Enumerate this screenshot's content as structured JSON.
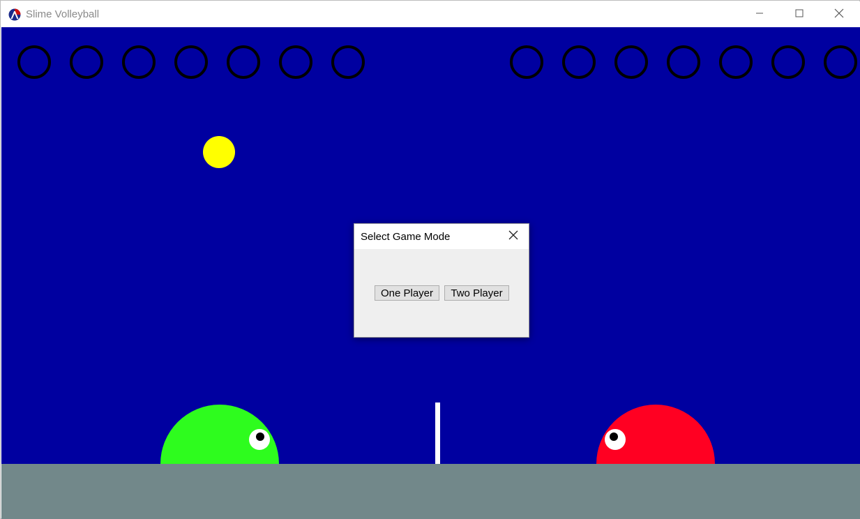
{
  "window": {
    "title": "Slime Volleyball",
    "controls": [
      "minimize-icon",
      "maximize-icon",
      "close-icon"
    ]
  },
  "game": {
    "background_color": "#0000a0",
    "ground_color": "#72888a",
    "net_color": "#ffffff",
    "ball_color": "#ffff00",
    "left_player": {
      "color": "#2efc1e",
      "points_remaining": 7
    },
    "right_player": {
      "color": "#ff0022",
      "points_remaining": 7
    }
  },
  "dialog": {
    "title": "Select Game Mode",
    "close_icon": "close-icon",
    "one_player_label": "One Player",
    "two_player_label": "Two Player"
  }
}
